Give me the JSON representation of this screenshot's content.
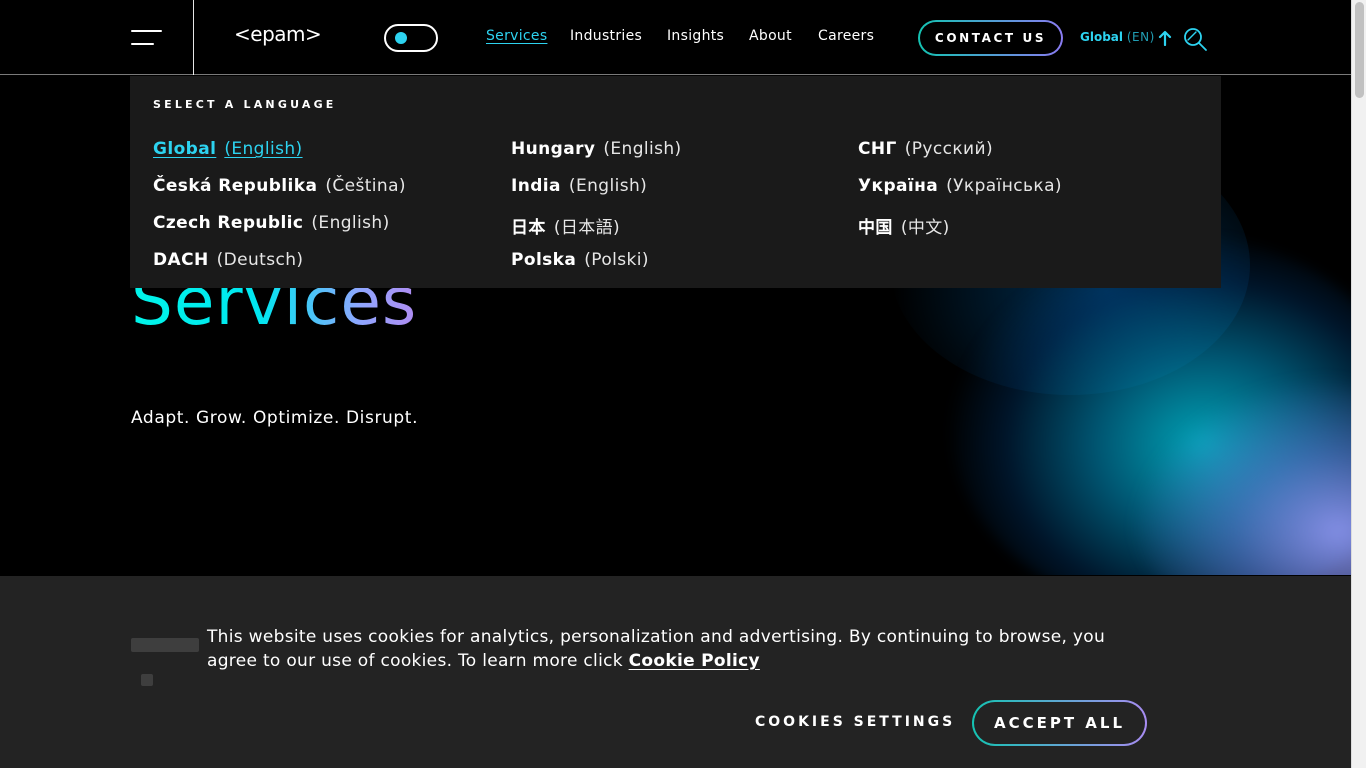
{
  "header": {
    "logo_text": "<epam>",
    "nav": [
      {
        "label": "Services",
        "active": true
      },
      {
        "label": "Industries"
      },
      {
        "label": "Insights"
      },
      {
        "label": "About"
      },
      {
        "label": "Careers"
      }
    ],
    "contact_label": "CONTACT US",
    "language_region": "Global",
    "language_code": "(EN)",
    "icons": [
      "hamburger-menu-icon",
      "theme-toggle",
      "arrow-up-icon",
      "search-icon"
    ],
    "accent_color": "#2dd3f0"
  },
  "language_menu": {
    "heading": "SELECT A LANGUAGE",
    "columns": [
      [
        {
          "country": "Global",
          "language": "(English)",
          "active": true
        },
        {
          "country": "Česká Republika",
          "language": "(Čeština)"
        },
        {
          "country": "Czech Republic",
          "language": "(English)"
        },
        {
          "country": "DACH",
          "language": "(Deutsch)"
        }
      ],
      [
        {
          "country": "Hungary",
          "language": "(English)"
        },
        {
          "country": "India",
          "language": "(English)"
        },
        {
          "country": "日本",
          "language": "(日本語)"
        },
        {
          "country": "Polska",
          "language": "(Polski)"
        }
      ],
      [
        {
          "country": "СНГ",
          "language": "(Русский)"
        },
        {
          "country": "Україна",
          "language": "(Українська)"
        },
        {
          "country": "中国",
          "language": "(中文)"
        }
      ]
    ]
  },
  "hero": {
    "title": "Services",
    "subtitle": "Adapt. Grow. Optimize. Disrupt."
  },
  "cookie_banner": {
    "text": "This website uses cookies for analytics, personalization and advertising. By continuing to browse, you agree to our use of cookies. To learn more click ",
    "link": "Cookie Policy",
    "settings_label": "COOKIES SETTINGS",
    "accept_label": "ACCEPT ALL"
  }
}
